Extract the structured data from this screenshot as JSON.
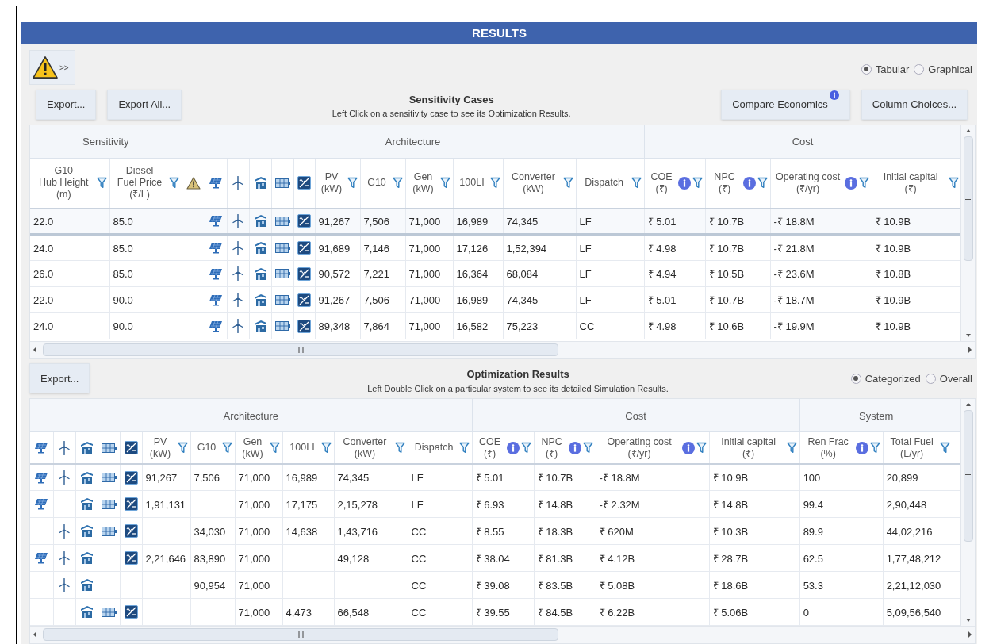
{
  "window": {
    "title": "RESULTS"
  },
  "warning_button": {
    "label": ">>"
  },
  "view_options": [
    {
      "label": "Tabular",
      "selected": true
    },
    {
      "label": "Graphical",
      "selected": false
    }
  ],
  "sensitivity": {
    "buttons": [
      {
        "label": "Export..."
      },
      {
        "label": "Export All..."
      }
    ],
    "title": "Sensitivity Cases",
    "subtitle": "Left Click on a sensitivity case to see its Optimization Results.",
    "right_buttons": [
      {
        "label": "Compare Economics",
        "info": true
      },
      {
        "label": "Column Choices...",
        "info": false
      }
    ],
    "table": {
      "groups": [
        {
          "label": "Sensitivity",
          "columns": [
            {
              "kind": "text",
              "lines": [
                "G10",
                "Hub Height",
                "(m)"
              ],
              "filter": true,
              "info": false
            },
            {
              "kind": "text",
              "lines": [
                "Diesel",
                "Fuel Price",
                "(₹/L)"
              ],
              "filter": true,
              "info": false
            }
          ]
        },
        {
          "label": "Architecture",
          "columns": [
            {
              "kind": "warning"
            },
            {
              "kind": "component"
            },
            {
              "kind": "component"
            },
            {
              "kind": "component"
            },
            {
              "kind": "component"
            },
            {
              "kind": "component"
            },
            {
              "kind": "text",
              "lines": [
                "PV",
                "(kW)"
              ],
              "filter": true,
              "info": false
            },
            {
              "kind": "text",
              "lines": [
                "G10"
              ],
              "filter": true,
              "info": false
            },
            {
              "kind": "text",
              "lines": [
                "Gen",
                "(kW)"
              ],
              "filter": true,
              "info": false
            },
            {
              "kind": "text",
              "lines": [
                "100LI"
              ],
              "filter": true,
              "info": false
            },
            {
              "kind": "text",
              "lines": [
                "Converter",
                "(kW)"
              ],
              "filter": true,
              "info": false
            },
            {
              "kind": "text",
              "lines": [
                "Dispatch"
              ],
              "filter": true,
              "info": false
            }
          ]
        },
        {
          "label": "Cost",
          "columns": [
            {
              "kind": "text",
              "lines": [
                "COE",
                "(₹)"
              ],
              "filter": true,
              "info": true
            },
            {
              "kind": "text",
              "lines": [
                "NPC",
                "(₹)"
              ],
              "filter": true,
              "info": true
            },
            {
              "kind": "text",
              "lines": [
                "Operating cost",
                "(₹/yr)"
              ],
              "filter": true,
              "info": true
            },
            {
              "kind": "text",
              "lines": [
                "Initial capital",
                "(₹)"
              ],
              "filter": true,
              "info": false
            }
          ]
        }
      ],
      "rows": [
        {
          "selected": true,
          "components": [
            true,
            true,
            true,
            true,
            true
          ],
          "cells": [
            "22.0",
            "85.0",
            "91,267",
            "7,506",
            "71,000",
            "16,989",
            "74,345",
            "LF",
            "₹ 5.01",
            "₹ 10.7B",
            "-₹ 18.8M",
            "₹ 10.9B"
          ]
        },
        {
          "selected": false,
          "components": [
            true,
            true,
            true,
            true,
            true
          ],
          "cells": [
            "24.0",
            "85.0",
            "91,689",
            "7,146",
            "71,000",
            "17,126",
            "1,52,394",
            "LF",
            "₹ 4.98",
            "₹ 10.7B",
            "-₹ 21.8M",
            "₹ 10.9B"
          ]
        },
        {
          "selected": false,
          "components": [
            true,
            true,
            true,
            true,
            true
          ],
          "cells": [
            "26.0",
            "85.0",
            "90,572",
            "7,221",
            "71,000",
            "16,364",
            "68,084",
            "LF",
            "₹ 4.94",
            "₹ 10.5B",
            "-₹ 23.6M",
            "₹ 10.8B"
          ]
        },
        {
          "selected": false,
          "components": [
            true,
            true,
            true,
            true,
            true
          ],
          "cells": [
            "22.0",
            "90.0",
            "91,267",
            "7,506",
            "71,000",
            "16,989",
            "74,345",
            "LF",
            "₹ 5.01",
            "₹ 10.7B",
            "-₹ 18.7M",
            "₹ 10.9B"
          ]
        },
        {
          "selected": false,
          "components": [
            true,
            true,
            true,
            true,
            true
          ],
          "cells": [
            "24.0",
            "90.0",
            "89,348",
            "7,864",
            "71,000",
            "16,582",
            "75,223",
            "CC",
            "₹ 4.98",
            "₹ 10.6B",
            "-₹ 19.9M",
            "₹ 10.9B"
          ]
        }
      ]
    }
  },
  "optimization": {
    "buttons": [
      {
        "label": "Export..."
      }
    ],
    "title": "Optimization Results",
    "subtitle": "Left Double Click on a particular system to see its detailed Simulation Results.",
    "options": [
      {
        "label": "Categorized",
        "selected": true
      },
      {
        "label": "Overall",
        "selected": false
      }
    ],
    "table": {
      "groups": [
        {
          "label": "Architecture",
          "columns": [
            {
              "kind": "component"
            },
            {
              "kind": "component"
            },
            {
              "kind": "component"
            },
            {
              "kind": "component"
            },
            {
              "kind": "component"
            },
            {
              "kind": "text",
              "lines": [
                "PV",
                "(kW)"
              ],
              "filter": true,
              "info": false
            },
            {
              "kind": "text",
              "lines": [
                "G10"
              ],
              "filter": true,
              "info": false
            },
            {
              "kind": "text",
              "lines": [
                "Gen",
                "(kW)"
              ],
              "filter": true,
              "info": false
            },
            {
              "kind": "text",
              "lines": [
                "100LI"
              ],
              "filter": true,
              "info": false
            },
            {
              "kind": "text",
              "lines": [
                "Converter",
                "(kW)"
              ],
              "filter": true,
              "info": false
            },
            {
              "kind": "text",
              "lines": [
                "Dispatch"
              ],
              "filter": true,
              "info": false
            }
          ]
        },
        {
          "label": "Cost",
          "columns": [
            {
              "kind": "text",
              "lines": [
                "COE",
                "(₹)"
              ],
              "filter": true,
              "info": true
            },
            {
              "kind": "text",
              "lines": [
                "NPC",
                "(₹)"
              ],
              "filter": true,
              "info": true
            },
            {
              "kind": "text",
              "lines": [
                "Operating cost",
                "(₹/yr)"
              ],
              "filter": true,
              "info": true
            },
            {
              "kind": "text",
              "lines": [
                "Initial capital",
                "(₹)"
              ],
              "filter": true,
              "info": false
            }
          ]
        },
        {
          "label": "System",
          "columns": [
            {
              "kind": "text",
              "lines": [
                "Ren Frac",
                "(%)"
              ],
              "filter": true,
              "info": true
            },
            {
              "kind": "text",
              "lines": [
                "Total Fuel",
                "(L/yr)"
              ],
              "filter": true,
              "info": false
            }
          ]
        }
      ],
      "rows": [
        {
          "components": [
            true,
            true,
            true,
            true,
            true
          ],
          "cells": [
            "91,267",
            "7,506",
            "71,000",
            "16,989",
            "74,345",
            "LF",
            "₹ 5.01",
            "₹ 10.7B",
            "-₹ 18.8M",
            "₹ 10.9B",
            "100",
            "20,899"
          ]
        },
        {
          "components": [
            true,
            false,
            true,
            true,
            true
          ],
          "cells": [
            "1,91,131",
            "",
            "71,000",
            "17,175",
            "2,15,278",
            "LF",
            "₹ 6.93",
            "₹ 14.8B",
            "-₹ 2.32M",
            "₹ 14.8B",
            "99.4",
            "2,90,448"
          ]
        },
        {
          "components": [
            false,
            true,
            true,
            true,
            true
          ],
          "cells": [
            "",
            "34,030",
            "71,000",
            "14,638",
            "1,43,716",
            "CC",
            "₹ 8.55",
            "₹ 18.3B",
            "₹ 620M",
            "₹ 10.3B",
            "89.9",
            "44,02,216"
          ]
        },
        {
          "components": [
            true,
            true,
            true,
            false,
            true
          ],
          "cells": [
            "2,21,646",
            "83,890",
            "71,000",
            "",
            "49,128",
            "CC",
            "₹ 38.04",
            "₹ 81.3B",
            "₹ 4.12B",
            "₹ 28.7B",
            "62.5",
            "1,77,48,212"
          ]
        },
        {
          "components": [
            false,
            true,
            true,
            false,
            false
          ],
          "cells": [
            "",
            "90,954",
            "71,000",
            "",
            "",
            "CC",
            "₹ 39.08",
            "₹ 83.5B",
            "₹ 5.08B",
            "₹ 18.6B",
            "53.3",
            "2,21,12,030"
          ]
        },
        {
          "components": [
            false,
            false,
            true,
            true,
            true
          ],
          "cells": [
            "",
            "",
            "71,000",
            "4,473",
            "66,548",
            "CC",
            "₹ 39.55",
            "₹ 84.5B",
            "₹ 6.22B",
            "₹ 5.06B",
            "0",
            "5,09,56,540"
          ]
        }
      ]
    }
  }
}
